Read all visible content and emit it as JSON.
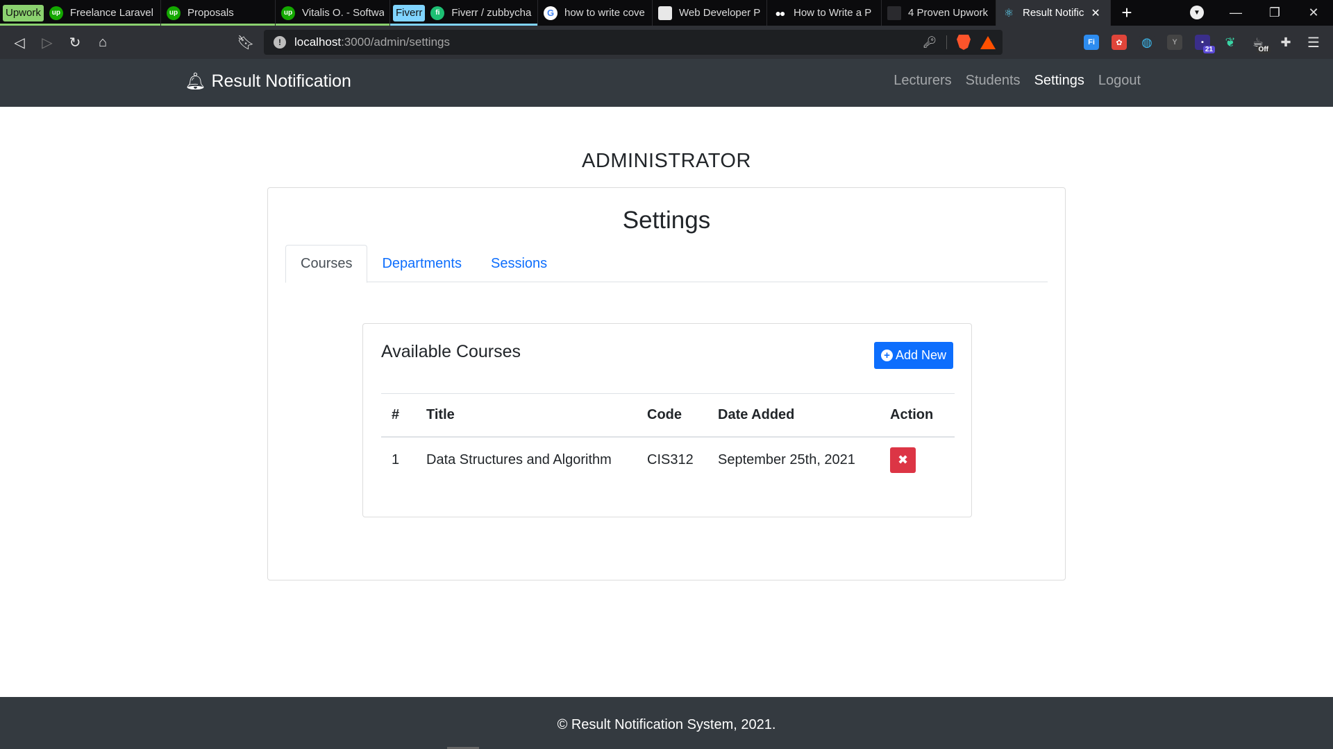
{
  "browser": {
    "tabs": [
      {
        "group": "Upwork",
        "group_color": "#8bd16f",
        "icon": "upwork-icon",
        "fav": "up",
        "label": "Freelance Laravel",
        "underline": "#8bd16f"
      },
      {
        "icon": "upwork-icon",
        "fav": "up",
        "label": "Proposals",
        "underline": "#8bd16f"
      },
      {
        "icon": "upwork-icon",
        "fav": "up",
        "label": "Vitalis O. - Softwa",
        "underline": "#8bd16f"
      },
      {
        "group": "Fiverr",
        "group_color": "#80d4ff",
        "icon": "fiverr-icon",
        "fav": "fi",
        "label": "Fiverr / zubbychar",
        "underline": "#80d4ff"
      },
      {
        "icon": "google-icon",
        "fav": "G",
        "label": "how to write cove"
      },
      {
        "icon": "webdev-icon",
        "fav": "",
        "label": "Web Developer P"
      },
      {
        "icon": "medium-icon",
        "fav": "●●",
        "label": "How to Write a P"
      },
      {
        "icon": "page-icon",
        "fav": "",
        "label": "4 Proven Upwork"
      },
      {
        "icon": "react-icon",
        "fav": "⚛",
        "label": "Result Notific",
        "active": true
      }
    ],
    "url_host": "localhost",
    "url_path": ":3000/admin/settings",
    "extension_badges": {
      "count": "21",
      "off": "Off"
    }
  },
  "navbar": {
    "brand": "Result Notification",
    "links": [
      "Lecturers",
      "Students",
      "Settings",
      "Logout"
    ],
    "active_link": "Settings"
  },
  "page": {
    "heading": "ADMINISTRATOR",
    "settings_title": "Settings",
    "tabs": [
      "Courses",
      "Departments",
      "Sessions"
    ],
    "active_tab": "Courses"
  },
  "courses": {
    "title": "Available Courses",
    "add_label": "Add New",
    "columns": [
      "#",
      "Title",
      "Code",
      "Date Added",
      "Action"
    ],
    "rows": [
      {
        "num": "1",
        "title": "Data Structures and Algorithm",
        "code": "CIS312",
        "date": "September 25th, 2021"
      }
    ]
  },
  "footer": {
    "text": "© Result Notification System, 2021."
  },
  "colors": {
    "primary": "#0d6efd",
    "danger": "#dc3545",
    "navbar": "#343a40"
  }
}
